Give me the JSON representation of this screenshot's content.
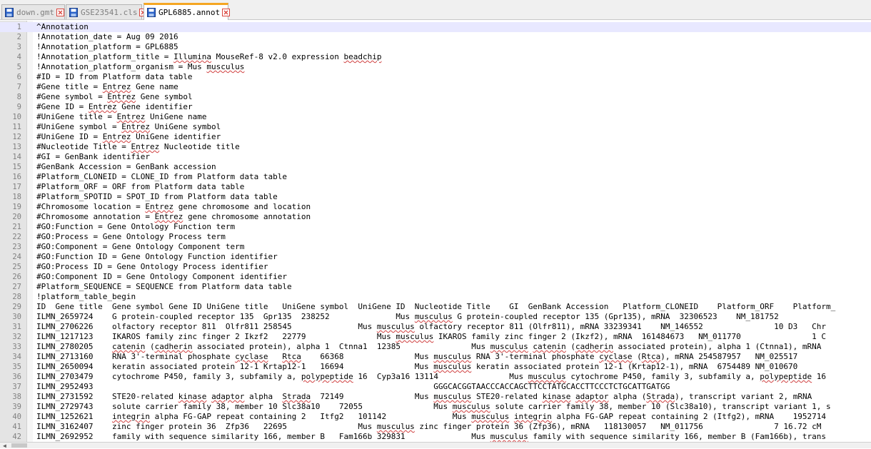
{
  "tabs": [
    {
      "label": "down.gmt",
      "active": false
    },
    {
      "label": "GSE23541.cls",
      "active": false
    },
    {
      "label": "GPL6885.annot",
      "active": true
    }
  ],
  "colors": {
    "accent": "#f5a623",
    "current_line": "#e8e8ff",
    "close_icon": "#d9463e",
    "save_icon": "#2a62c9"
  },
  "lines": [
    {
      "n": "1",
      "text": "^Annotation"
    },
    {
      "n": "2",
      "text": "!Annotation_date = Aug 09 2016"
    },
    {
      "n": "3",
      "text": "!Annotation_platform = GPL6885"
    },
    {
      "n": "4",
      "text": "!Annotation_platform_title = Illumina MouseRef-8 v2.0 expression beadchip"
    },
    {
      "n": "5",
      "text": "!Annotation_platform_organism = Mus musculus"
    },
    {
      "n": "6",
      "text": "#ID = ID from Platform data table"
    },
    {
      "n": "7",
      "text": "#Gene title = Entrez Gene name"
    },
    {
      "n": "8",
      "text": "#Gene symbol = Entrez Gene symbol"
    },
    {
      "n": "9",
      "text": "#Gene ID = Entrez Gene identifier"
    },
    {
      "n": "10",
      "text": "#UniGene title = Entrez UniGene name"
    },
    {
      "n": "11",
      "text": "#UniGene symbol = Entrez UniGene symbol"
    },
    {
      "n": "12",
      "text": "#UniGene ID = Entrez UniGene identifier"
    },
    {
      "n": "13",
      "text": "#Nucleotide Title = Entrez Nucleotide title"
    },
    {
      "n": "14",
      "text": "#GI = GenBank identifier"
    },
    {
      "n": "15",
      "text": "#GenBank Accession = GenBank accession"
    },
    {
      "n": "16",
      "text": "#Platform_CLONEID = CLONE_ID from Platform data table"
    },
    {
      "n": "17",
      "text": "#Platform_ORF = ORF from Platform data table"
    },
    {
      "n": "18",
      "text": "#Platform_SPOTID = SPOT_ID from Platform data table"
    },
    {
      "n": "19",
      "text": "#Chromosome location = Entrez gene chromosome and location"
    },
    {
      "n": "20",
      "text": "#Chromosome annotation = Entrez gene chromosome annotation"
    },
    {
      "n": "21",
      "text": "#GO:Function = Gene Ontology Function term"
    },
    {
      "n": "22",
      "text": "#GO:Process = Gene Ontology Process term"
    },
    {
      "n": "23",
      "text": "#GO:Component = Gene Ontology Component term"
    },
    {
      "n": "24",
      "text": "#GO:Function ID = Gene Ontology Function identifier"
    },
    {
      "n": "25",
      "text": "#GO:Process ID = Gene Ontology Process identifier"
    },
    {
      "n": "26",
      "text": "#GO:Component ID = Gene Ontology Component identifier"
    },
    {
      "n": "27",
      "text": "#Platform_SEQUENCE = SEQUENCE from Platform data table"
    },
    {
      "n": "28",
      "text": "!platform_table_begin"
    },
    {
      "n": "29",
      "text": "ID  Gene title  Gene symbol Gene ID UniGene title   UniGene symbol  UniGene ID  Nucleotide Title    GI  GenBank Accession   Platform_CLONEID    Platform_ORF    Platform_"
    },
    {
      "n": "30",
      "text": "ILMN_2659724    G protein-coupled receptor 135  Gpr135  238252              Mus musculus G protein-coupled receptor 135 (Gpr135), mRNA  32306523    NM_181752"
    },
    {
      "n": "31",
      "text": "ILMN_2706226    olfactory receptor 811  Olfr811 258545              Mus musculus olfactory receptor 811 (Olfr811), mRNA 33239341    NM_146552               10 D3   Chr"
    },
    {
      "n": "32",
      "text": "ILMN_1217123    IKAROS family zinc finger 2 Ikzf2   22779               Mus musculus IKAROS family zinc finger 2 (Ikzf2), mRNA  161484673   NM_011770               1 C"
    },
    {
      "n": "33",
      "text": "ILMN_2780205    catenin (cadherin associated protein), alpha 1  Ctnna1  12385               Mus musculus catenin (cadherin associated protein), alpha 1 (Ctnna1), mRNA"
    },
    {
      "n": "34",
      "text": "ILMN_2713160    RNA 3'-terminal phosphate cyclase   Rtca    66368               Mus musculus RNA 3'-terminal phosphate cyclase (Rtca), mRNA 254587957   NM_025517"
    },
    {
      "n": "35",
      "text": "ILMN_2650094    keratin associated protein 12-1 Krtap12-1   16694               Mus musculus keratin associated protein 12-1 (Krtap12-1), mRNA  6754489 NM_010670"
    },
    {
      "n": "36",
      "text": "ILMN_2703479    cytochrome P450, family 3, subfamily a, polypeptide 16  Cyp3a16 13114               Mus musculus cytochrome P450, family 3, subfamily a, polypeptide 16"
    },
    {
      "n": "37",
      "text": "ILMN_2952493                                                                        GGGCACGGTAACCCACCAGCTTCCTATGCACCTTCCCTCTGCATTGATGG"
    },
    {
      "n": "38",
      "text": "ILMN_2731592    STE20-related kinase adaptor alpha  Strada  72149               Mus musculus STE20-related kinase adaptor alpha (Strada), transcript variant 2, mRNA"
    },
    {
      "n": "39",
      "text": "ILMN_2729743    solute carrier family 38, member 10 Slc38a10    72055               Mus musculus solute carrier family 38, member 10 (Slc38a10), transcript variant 1, s"
    },
    {
      "n": "40",
      "text": "ILMN_1252621    integrin alpha FG-GAP repeat containing 2   Itfg2   101142              Mus musculus integrin alpha FG-GAP repeat containing 2 (Itfg2), mRNA    1952714"
    },
    {
      "n": "41",
      "text": "ILMN_3162407    zinc finger protein 36  Zfp36   22695               Mus musculus zinc finger protein 36 (Zfp36), mRNA   118130057   NM_011756               7 16.72 cM"
    },
    {
      "n": "42",
      "text": "ILMN_2692952    family with sequence similarity 166, member B   Fam166b 329831              Mus musculus family with sequence similarity 166, member B (Fam166b), trans"
    }
  ]
}
